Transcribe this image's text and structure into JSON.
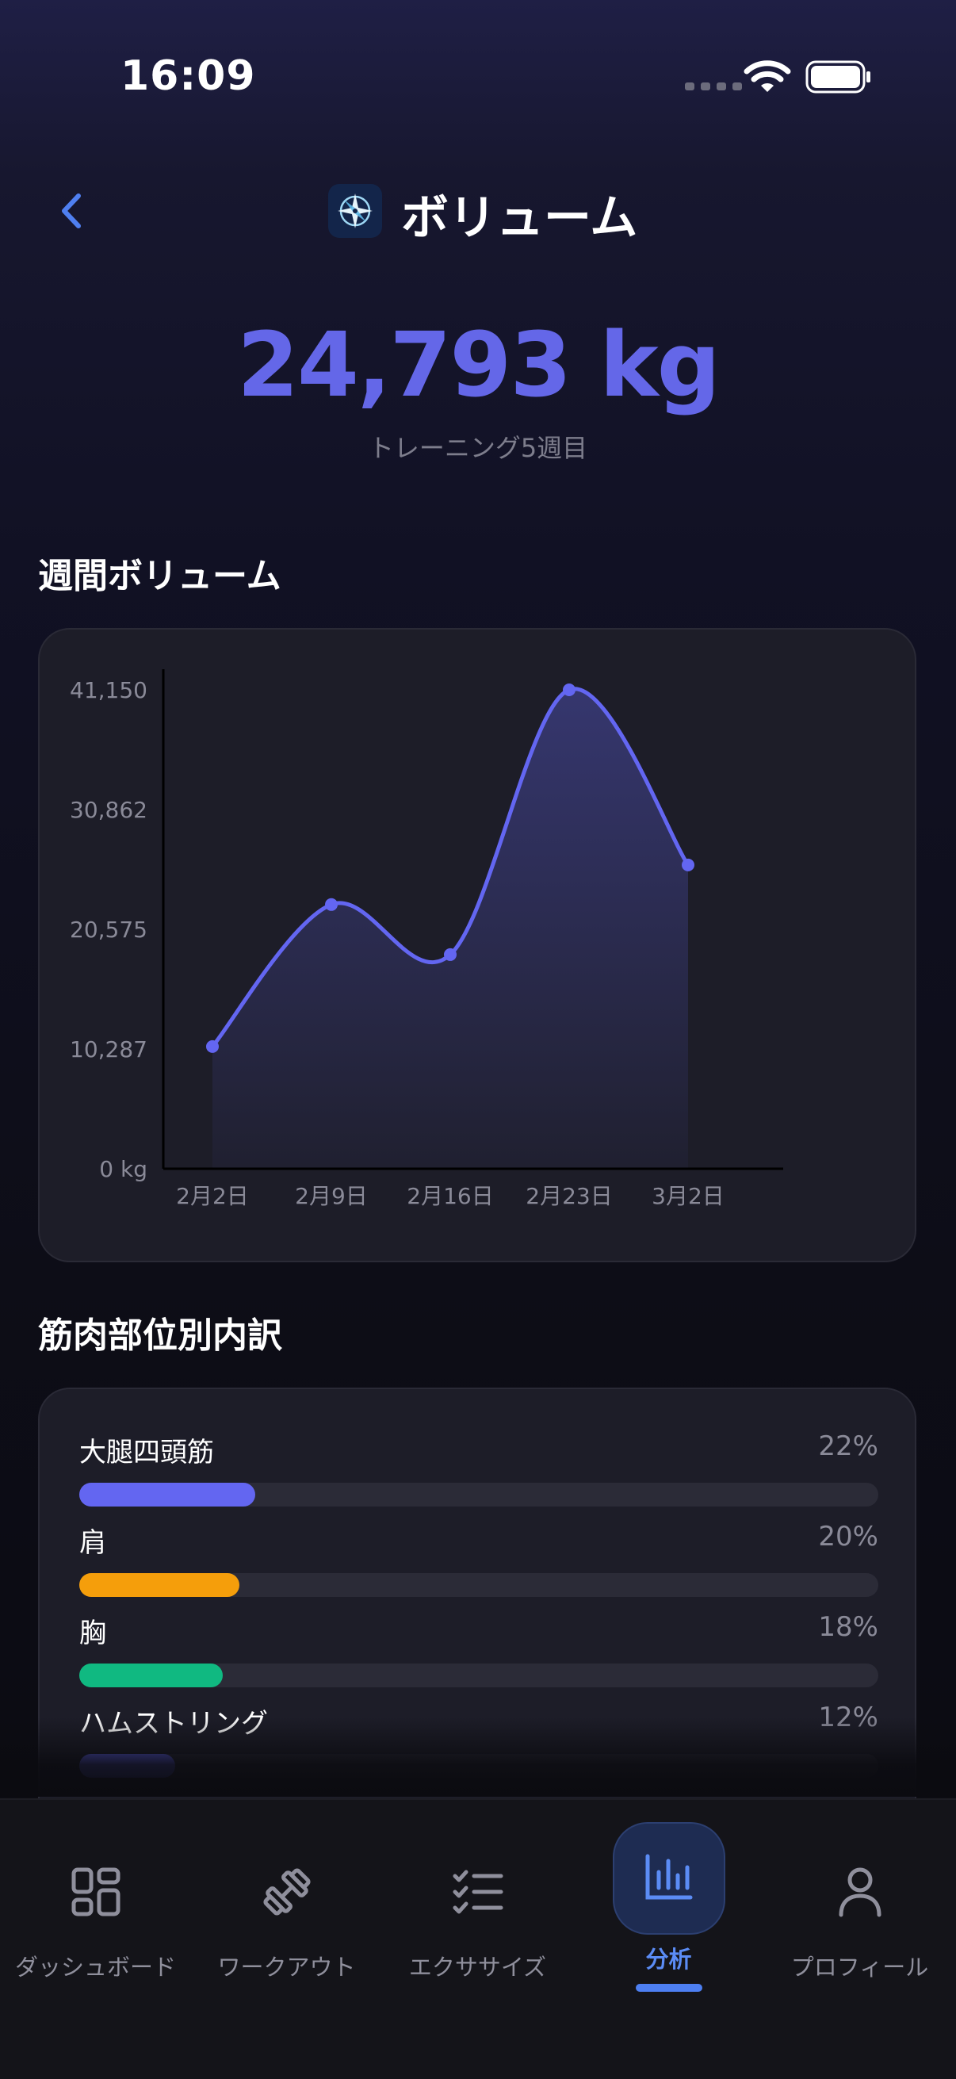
{
  "status_bar": {
    "time": "16:09"
  },
  "header": {
    "title": "ボリューム",
    "icon": "compass-icon"
  },
  "summary": {
    "value": "24,793 kg",
    "subtitle": "トレーニング5週目"
  },
  "weekly_section": {
    "title": "週間ボリューム"
  },
  "chart_data": {
    "type": "area",
    "x": [
      "2月2日",
      "2月9日",
      "2月16日",
      "2月23日",
      "3月2日"
    ],
    "series": [
      {
        "values": [
          10500,
          22700,
          18400,
          41150,
          26100
        ]
      }
    ],
    "yticks": [
      "0 kg",
      "10,287",
      "20,575",
      "30,862",
      "41,150"
    ],
    "ylim": [
      0,
      41150
    ],
    "grid": false,
    "line_color": "#6366f1"
  },
  "muscle_section": {
    "title": "筋肉部位別内訳",
    "items": [
      {
        "name": "大腿四頭筋",
        "percent": "22%",
        "value": 22,
        "color": "#6366f1"
      },
      {
        "name": "肩",
        "percent": "20%",
        "value": 20,
        "color": "#f59e0b"
      },
      {
        "name": "胸",
        "percent": "18%",
        "value": 18,
        "color": "#10b981"
      },
      {
        "name": "ハムストリング",
        "percent": "12%",
        "value": 12,
        "color": "#6366f1"
      }
    ]
  },
  "tabbar": {
    "tabs": [
      {
        "label": "ダッシュボード",
        "icon": "dashboard-grid-icon",
        "active": false
      },
      {
        "label": "ワークアウト",
        "icon": "dumbbell-icon",
        "active": false
      },
      {
        "label": "エクササイズ",
        "icon": "checklist-icon",
        "active": false
      },
      {
        "label": "分析",
        "icon": "bar-chart-icon",
        "active": true
      },
      {
        "label": "プロフィール",
        "icon": "person-icon",
        "active": false
      }
    ]
  }
}
